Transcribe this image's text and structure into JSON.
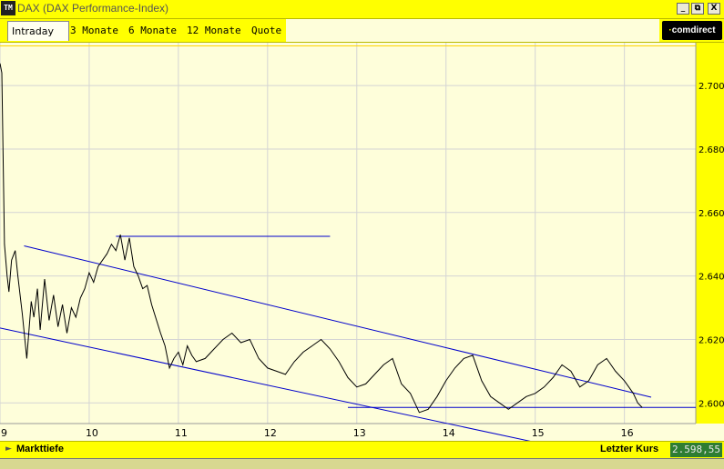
{
  "window": {
    "title": "DAX (DAX Performance-Index)",
    "icon_text": "TM"
  },
  "window_buttons": {
    "minimize": "_",
    "restore": "⧉",
    "close": "X"
  },
  "tabs": [
    {
      "label": "Intraday",
      "active": true
    },
    {
      "label": "3 Monate",
      "active": false
    },
    {
      "label": "6 Monate",
      "active": false
    },
    {
      "label": "12 Monate",
      "active": false
    },
    {
      "label": "Quote",
      "active": false
    }
  ],
  "brand": "comdirect",
  "footer": {
    "depth_label": "Markttiefe",
    "last_label": "Letzter Kurs",
    "last_value": "2.598,55"
  },
  "colors": {
    "accent": "#ffff00",
    "chart_bg": "#fefeda",
    "price_line": "#000000",
    "trend_line": "#0000cc",
    "last_bg": "#2e7d32"
  },
  "chart_data": {
    "type": "line",
    "x_ticks": [
      "9",
      "10",
      "11",
      "12",
      "13",
      "14",
      "15",
      "16"
    ],
    "y_ticks": [
      "2.600",
      "2.620",
      "2.640",
      "2.660",
      "2.680",
      "2.700"
    ],
    "xlim": [
      9.0,
      16.8
    ],
    "ylim": [
      2593.5,
      2713.5
    ],
    "series": [
      {
        "x": [
          9.0,
          9.02,
          9.05,
          9.08,
          9.1,
          9.13,
          9.17,
          9.2,
          9.25,
          9.3,
          9.35,
          9.38,
          9.42,
          9.45,
          9.5,
          9.55,
          9.6,
          9.65,
          9.7,
          9.75,
          9.8,
          9.85,
          9.9,
          9.95,
          10.0,
          10.05,
          10.1,
          10.15,
          10.2,
          10.25,
          10.3,
          10.35,
          10.4,
          10.45,
          10.5,
          10.55,
          10.6,
          10.65,
          10.7,
          10.8,
          10.85,
          10.9,
          10.95,
          11.0,
          11.05,
          11.1,
          11.15,
          11.2,
          11.3,
          11.4,
          11.5,
          11.6,
          11.7,
          11.8,
          11.9,
          12.0,
          12.1,
          12.2,
          12.3,
          12.4,
          12.5,
          12.6,
          12.7,
          12.8,
          12.9,
          13.0,
          13.1,
          13.2,
          13.3,
          13.4,
          13.5,
          13.6,
          13.7,
          13.8,
          13.9,
          14.0,
          14.1,
          14.2,
          14.3,
          14.4,
          14.5,
          14.6,
          14.7,
          14.8,
          14.9,
          15.0,
          15.1,
          15.2,
          15.3,
          15.4,
          15.5,
          15.6,
          15.7,
          15.8,
          15.9,
          16.0,
          16.05,
          16.1,
          16.15,
          16.2
        ],
        "values": [
          2707,
          2704,
          2650,
          2640,
          2635,
          2645,
          2648,
          2640,
          2628,
          2614,
          2632,
          2627,
          2636,
          2623,
          2639,
          2626,
          2634,
          2624,
          2631,
          2622,
          2630,
          2627,
          2633,
          2636,
          2641,
          2638,
          2643,
          2645,
          2647,
          2650,
          2648,
          2653,
          2645,
          2652,
          2643,
          2640,
          2636,
          2637,
          2631,
          2622,
          2618,
          2611,
          2614,
          2616,
          2612,
          2618,
          2615,
          2613,
          2614,
          2617,
          2620,
          2622,
          2619,
          2620,
          2614,
          2611,
          2610,
          2609,
          2613,
          2616,
          2618,
          2620,
          2617,
          2613,
          2608,
          2605,
          2606,
          2609,
          2612,
          2614,
          2606,
          2603,
          2597,
          2598,
          2602,
          2607,
          2611,
          2614,
          2615,
          2607,
          2602,
          2600,
          2598,
          2600,
          2602,
          2603,
          2605,
          2608,
          2612,
          2610,
          2605,
          2607,
          2612,
          2614,
          2610,
          2607,
          2605,
          2603,
          2600,
          2598.55
        ]
      }
    ],
    "trend_lines": [
      {
        "from": [
          9.27,
          2649.5
        ],
        "to": [
          16.3,
          2601.8
        ]
      },
      {
        "from": [
          9.0,
          2623.6
        ],
        "to": [
          16.35,
          2579.5
        ]
      },
      {
        "from": [
          10.3,
          2652.5
        ],
        "to": [
          12.7,
          2652.5
        ]
      },
      {
        "from": [
          12.9,
          2598.6
        ],
        "to": [
          16.8,
          2598.6
        ]
      }
    ],
    "reference_line": 2712.5,
    "grid": true
  }
}
